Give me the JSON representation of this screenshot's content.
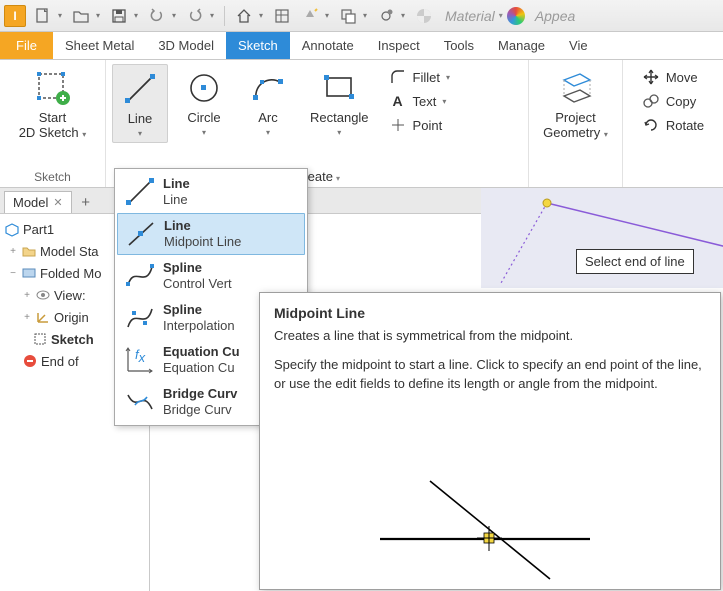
{
  "qat": {
    "logo": "I"
  },
  "material": {
    "label": "Material",
    "appearance": "Appea"
  },
  "tabs": {
    "file": "File",
    "items": [
      "Sheet Metal",
      "3D Model",
      "Sketch",
      "Annotate",
      "Inspect",
      "Tools",
      "Manage",
      "Vie"
    ],
    "active_index": 2
  },
  "ribbon": {
    "sketch_panel": {
      "title": "Sketch",
      "start_l1": "Start",
      "start_l2": "2D Sketch"
    },
    "create_panel": {
      "title": "Create",
      "line": "Line",
      "circle": "Circle",
      "arc": "Arc",
      "rectangle": "Rectangle",
      "fillet": "Fillet",
      "text": "Text",
      "point": "Point"
    },
    "project_panel": {
      "project_l1": "Project",
      "project_l2": "Geometry"
    },
    "modify_panel": {
      "move": "Move",
      "copy": "Copy",
      "rotate": "Rotate"
    }
  },
  "browser": {
    "tab": "Model",
    "root": "Part1",
    "nodes": [
      "Model Sta",
      "Folded Mo",
      "View:",
      "Origin",
      "Sketch",
      "End of"
    ]
  },
  "line_menu": {
    "items": [
      {
        "title": "Line",
        "sub": "Line"
      },
      {
        "title": "Line",
        "sub": "Midpoint Line"
      },
      {
        "title": "Spline",
        "sub": "Control Vert"
      },
      {
        "title": "Spline",
        "sub": "Interpolation"
      },
      {
        "title": "Equation Cu",
        "sub": "Equation Cu"
      },
      {
        "title": "Bridge Curv",
        "sub": "Bridge Curv"
      }
    ],
    "selected_index": 1
  },
  "tooltip": {
    "title": "Midpoint Line",
    "p1": "Creates a line that is symmetrical from the midpoint.",
    "p2": "Specify the midpoint to start a line. Click to specify an end point of the line, or use the edit fields to define its length or angle from the midpoint."
  },
  "hint": "Select end of line"
}
